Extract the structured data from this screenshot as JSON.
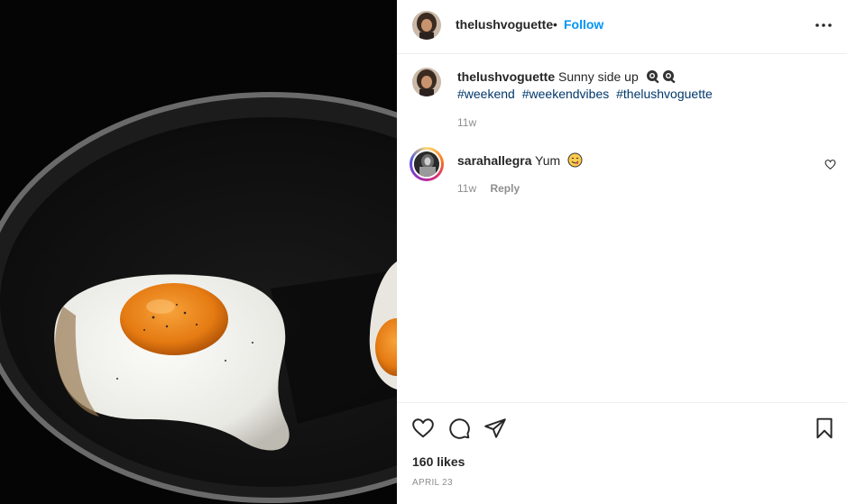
{
  "post": {
    "author": "thelushvoguette",
    "separator": "•",
    "follow_label": "Follow",
    "more_icon": "more-horizontal-icon"
  },
  "caption": {
    "username": "thelushvoguette",
    "text": "Sunny side up",
    "emoji": [
      "fried-egg-emoji",
      "fried-egg-emoji"
    ],
    "hashtags": [
      "#weekend",
      "#weekendvibes",
      "#thelushvoguette"
    ],
    "time": "11w"
  },
  "comments": [
    {
      "username": "sarahallegra",
      "text": "Yum",
      "emoji": "yum-face-emoji",
      "time": "11w",
      "reply_label": "Reply",
      "like_icon": "heart-icon"
    }
  ],
  "actions": {
    "icons": [
      "heart-icon",
      "comment-icon",
      "share-icon",
      "bookmark-icon"
    ],
    "likes": "160 likes",
    "date": "APRIL 23"
  },
  "colors": {
    "follow": "#0095f6",
    "hashtag": "#00376b",
    "muted": "#8e8e8e",
    "text": "#262626"
  }
}
